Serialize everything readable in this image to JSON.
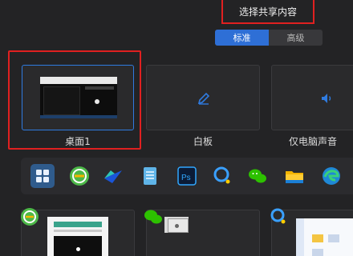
{
  "dialog": {
    "title": "选择共享内容"
  },
  "modes": {
    "standard": "标准",
    "advanced": "高级"
  },
  "sources": [
    {
      "label": "桌面1"
    },
    {
      "label": "白板"
    },
    {
      "label": "仅电脑声音"
    }
  ],
  "taskbar_icons": [
    "windows-start-icon",
    "360-browser-icon",
    "lark-icon",
    "notepad-icon",
    "photoshop-icon",
    "meeting-app-icon",
    "wechat-icon",
    "file-explorer-icon",
    "edge-browser-icon"
  ],
  "window_icons": [
    "360-browser-icon",
    "wechat-icon",
    "meeting-app-icon"
  ],
  "colors": {
    "accent": "#2e6fd6",
    "highlight": "#e02020",
    "background": "#232325"
  }
}
